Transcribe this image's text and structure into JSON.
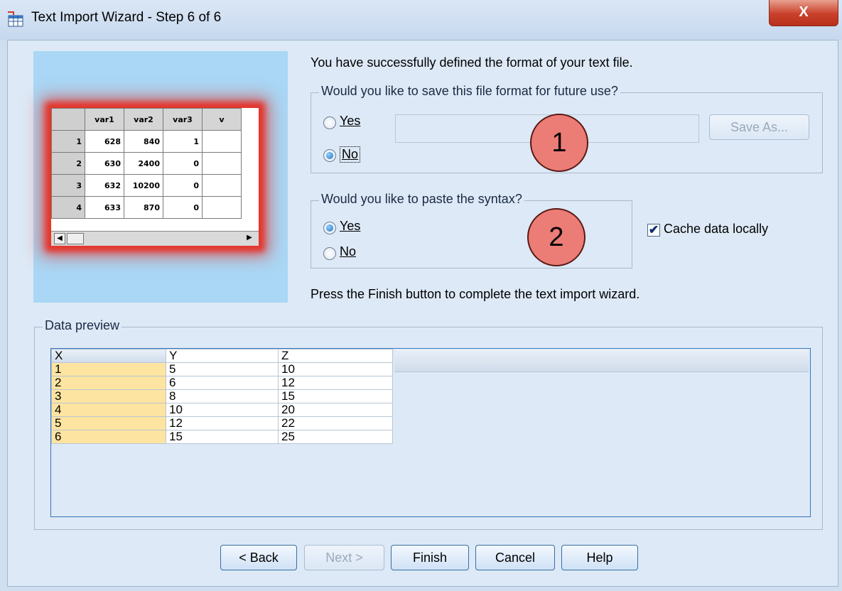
{
  "window": {
    "title": "Text Import Wizard - Step 6 of 6",
    "app_icon": "table-import-icon",
    "close_label": "X"
  },
  "preview_image": {
    "headers": [
      "",
      "var1",
      "var2",
      "var3",
      "v"
    ],
    "rows": [
      [
        "1",
        "628",
        "840",
        "1",
        ""
      ],
      [
        "2",
        "630",
        "2400",
        "0",
        ""
      ],
      [
        "3",
        "632",
        "10200",
        "0",
        ""
      ],
      [
        "4",
        "633",
        "870",
        "0",
        ""
      ]
    ]
  },
  "intro_text": "You have successfully defined the format of your text file.",
  "save_format": {
    "legend": "Would you like to save this file format for future use?",
    "yes_label": "Yes",
    "no_label": "No",
    "selected": "No",
    "file_name_value": "",
    "save_as_label": "Save As..."
  },
  "paste_syntax": {
    "legend": "Would you like to paste the syntax?",
    "yes_label": "Yes",
    "no_label": "No",
    "selected": "Yes"
  },
  "cache_data": {
    "label": "Cache data locally",
    "checked": true
  },
  "finish_text": "Press the Finish button to complete the text import wizard.",
  "callouts": [
    "1",
    "2"
  ],
  "data_preview": {
    "legend": "Data preview",
    "columns": [
      "X",
      "Y",
      "Z"
    ],
    "rows": [
      [
        "1",
        "5",
        "10"
      ],
      [
        "2",
        "6",
        "12"
      ],
      [
        "3",
        "8",
        "15"
      ],
      [
        "4",
        "10",
        "20"
      ],
      [
        "5",
        "12",
        "22"
      ],
      [
        "6",
        "15",
        "25"
      ]
    ]
  },
  "buttons": {
    "back": "< Back",
    "next": "Next >",
    "finish": "Finish",
    "cancel": "Cancel",
    "help": "Help"
  },
  "colors": {
    "callout_fill": "#ec7c76",
    "row_header_fill": "#fde4a0",
    "accent_border": "#3574b8"
  }
}
